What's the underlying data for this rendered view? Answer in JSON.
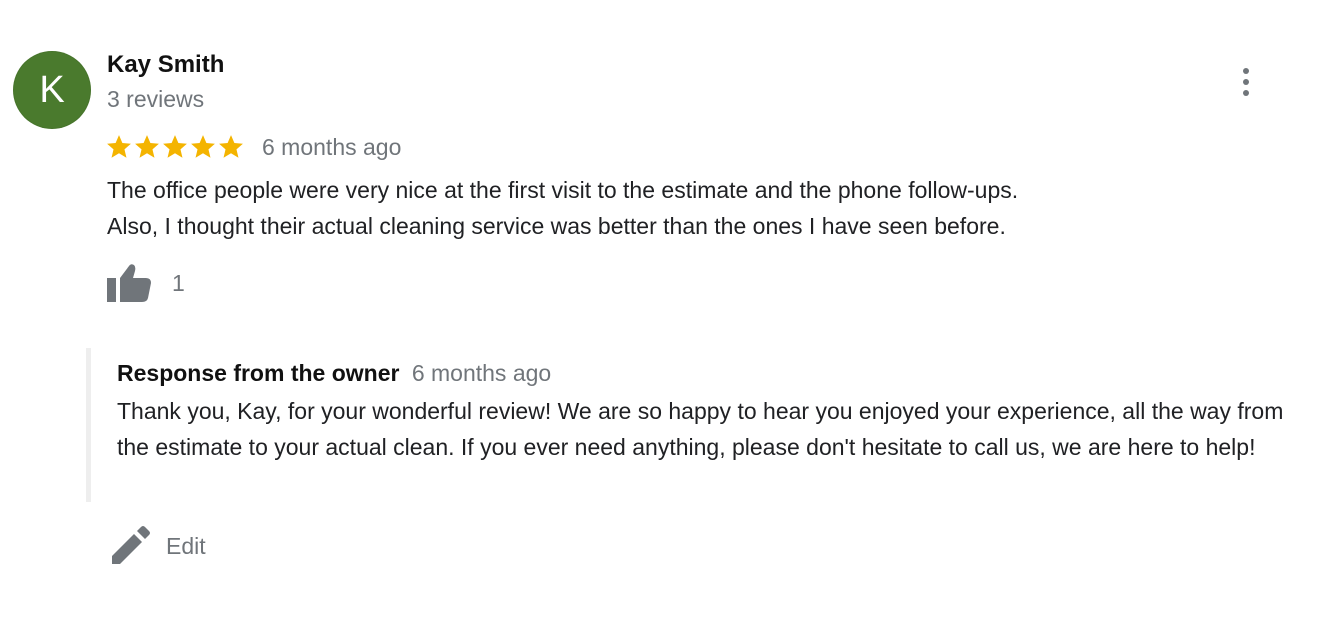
{
  "review": {
    "avatar_letter": "K",
    "avatar_color": "#4a7a2d",
    "reviewer_name": "Kay Smith",
    "review_count": "3 reviews",
    "rating": 5,
    "rating_max": 5,
    "star_color": "#f4b400",
    "date": "6 months ago",
    "text_lines": [
      "The office people were very nice at the first visit to the estimate and the phone follow-ups.",
      "Also, I thought  their actual cleaning service was better than the ones I have seen before."
    ],
    "like_count": "1",
    "more_icon": "more-vert-icon",
    "like_icon": "thumb-up-icon"
  },
  "owner_response": {
    "title": "Response from the owner",
    "date": "6 months ago",
    "text": "Thank you, Kay, for your wonderful review! We are so happy to hear you enjoyed your experience, all the way from the estimate to your actual clean. If you ever need anything, please don't hesitate to call us, we are here to help!"
  },
  "edit": {
    "label": "Edit",
    "icon": "pencil-icon"
  }
}
